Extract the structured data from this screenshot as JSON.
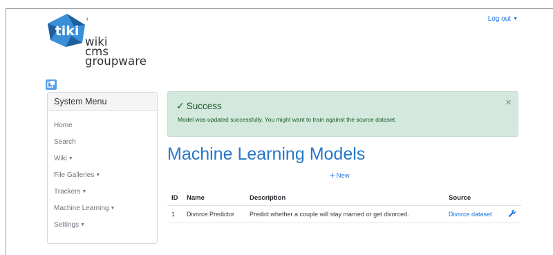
{
  "header": {
    "logo": {
      "mark": "tiki",
      "lines": [
        "wiki",
        "cms",
        "groupware"
      ]
    },
    "logout_label": "Log out"
  },
  "sidebar": {
    "title": "System Menu",
    "items": [
      {
        "label": "Home",
        "dropdown": false
      },
      {
        "label": "Search",
        "dropdown": false
      },
      {
        "label": "Wiki",
        "dropdown": true
      },
      {
        "label": "File Galleries",
        "dropdown": true
      },
      {
        "label": "Trackers",
        "dropdown": true
      },
      {
        "label": "Machine Learning",
        "dropdown": true
      },
      {
        "label": "Settings",
        "dropdown": true
      }
    ]
  },
  "alert": {
    "title": "Success",
    "message": "Model was updated successfully. You might want to train against the source dataset.",
    "close": "×"
  },
  "main": {
    "title": "Machine Learning Models",
    "new_label": "New"
  },
  "table": {
    "columns": [
      "ID",
      "Name",
      "Description",
      "Source"
    ],
    "rows": [
      {
        "id": "1",
        "name": "Divorce Predictor",
        "description": "Predict whether a couple will stay married or get divorced.",
        "source": "Divorce dataset"
      }
    ]
  },
  "colors": {
    "accent": "#1a73e8",
    "title": "#2677c9",
    "success_bg": "#d4e9de",
    "success_text": "#155724",
    "logo_blue": "#3a8fd9"
  },
  "icons": {
    "logout_caret": "caret-down-icon",
    "close": "close-icon",
    "check": "check-icon",
    "add": "plus-icon",
    "edit": "wrench-icon"
  }
}
